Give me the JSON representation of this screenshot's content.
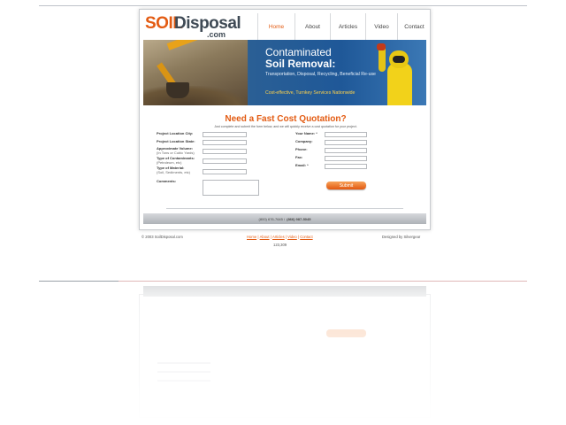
{
  "logo": {
    "soil": "SOIL",
    "disposal": "Disposal",
    "com": ".com"
  },
  "nav": {
    "items": [
      {
        "label": "Home",
        "active": true
      },
      {
        "label": "About",
        "active": false
      },
      {
        "label": "Articles",
        "active": false
      },
      {
        "label": "Video",
        "active": false
      },
      {
        "label": "Contact",
        "active": false
      }
    ]
  },
  "banner": {
    "title_line1": "Contaminated",
    "title_line2": "Soil Removal:",
    "subtitle": "Transportation, Disposal, Recycling, Beneficial Re-use",
    "tagline": "Cost-effective, Turnkey Services Nationwide"
  },
  "form": {
    "title": "Need a Fast Cost Quotation?",
    "intro": "Just complete and submit the form below, and we will quickly receive a cost quotation for your project.",
    "left_fields": [
      {
        "label": "Project Location City:",
        "sub": ""
      },
      {
        "label": "Project Location State:",
        "sub": ""
      },
      {
        "label": "Approximate Volume:",
        "sub": "(In Tons or Cubic Yards)"
      },
      {
        "label": "Type of Contaminants:",
        "sub": "(Petroleum, etc)"
      },
      {
        "label": "Type of Material:",
        "sub": "(Soil, Sediments, etc)"
      },
      {
        "label": "Comments:",
        "sub": ""
      }
    ],
    "right_fields": [
      {
        "label": "Your Name: *"
      },
      {
        "label": "Company:"
      },
      {
        "label": "Phone:"
      },
      {
        "label": "Fax:"
      },
      {
        "label": "Email: *"
      }
    ],
    "submit_label": "Submit"
  },
  "footer": {
    "phone1": "(800) 676-7645 /",
    "phone2": "(866) 987-5045",
    "copyright": "© 2003 SoilDisposal.com",
    "links": [
      "Home",
      "About",
      "Articles",
      "Video",
      "Contact"
    ],
    "separator": " | ",
    "counter": "123,309",
    "credit": "Designed by Silvergear"
  },
  "colors": {
    "accent": "#e35b12",
    "logo_dark": "#3f4a55",
    "banner_blue": "#1f5898"
  }
}
